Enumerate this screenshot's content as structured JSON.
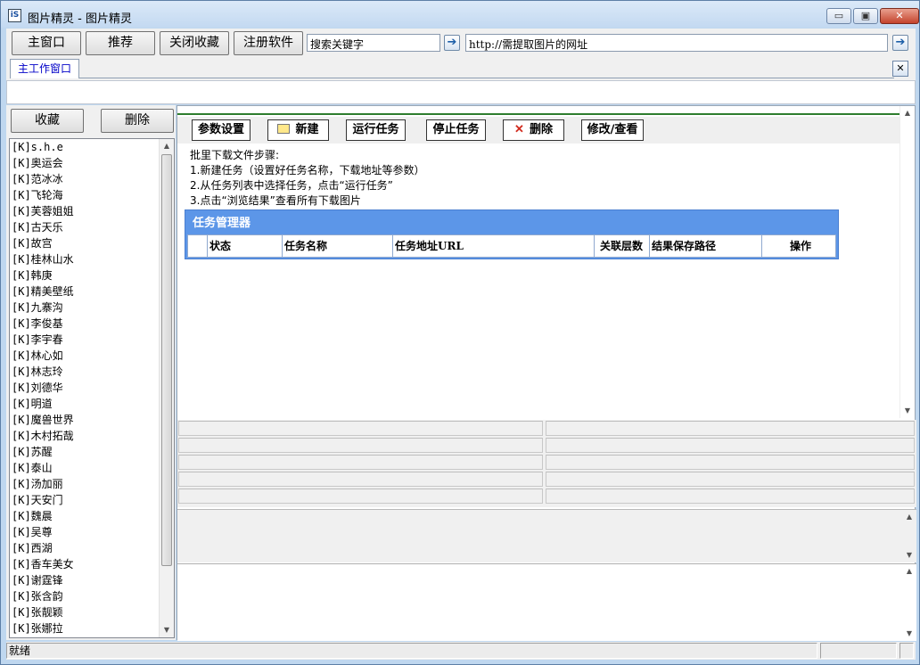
{
  "window": {
    "title": "图片精灵 - 图片精灵",
    "icon_text": "iS",
    "minimize": "▭",
    "maximize": "▣",
    "close": "✕"
  },
  "toolbar": {
    "main_window": "主窗口",
    "recommend": "推荐",
    "close_favorites": "关闭收藏",
    "register": "注册软件",
    "search_value": "搜索关键字",
    "url_value": "http://需提取图片的网址"
  },
  "tabs": {
    "main_work": "主工作窗口"
  },
  "sidebar": {
    "favorites_button": "收藏",
    "delete_button": "删除",
    "items": [
      "[K]s.h.e",
      "[K]奥运会",
      "[K]范冰冰",
      "[K]飞轮海",
      "[K]芙蓉姐姐",
      "[K]古天乐",
      "[K]故宫",
      "[K]桂林山水",
      "[K]韩庚",
      "[K]精美壁纸",
      "[K]九寨沟",
      "[K]李俊基",
      "[K]李宇春",
      "[K]林心如",
      "[K]林志玲",
      "[K]刘德华",
      "[K]明道",
      "[K]魔兽世界",
      "[K]木村拓哉",
      "[K]苏醒",
      "[K]泰山",
      "[K]汤加丽",
      "[K]天安门",
      "[K]魏晨",
      "[K]吴尊",
      "[K]西湖",
      "[K]香车美女",
      "[K]谢霆锋",
      "[K]张含韵",
      "[K]张靓颖",
      "[K]张娜拉"
    ]
  },
  "actions": {
    "params": "参数设置",
    "new": "新建",
    "run": "运行任务",
    "stop": "停止任务",
    "delete": "删除",
    "edit": "修改/查看"
  },
  "instructions": {
    "heading": "批里下载文件步骤:",
    "step1": "1.新建任务（设置好任务名称，下载地址等参数）",
    "step2": "2.从任务列表中选择任务，点击“运行任务”",
    "step3": "3.点击“浏览结果”查看所有下载图片"
  },
  "task_manager": {
    "title": "任务管理器",
    "columns": [
      "状态",
      "任务名称",
      "任务地址URL",
      "关联层数",
      "结果保存路径",
      "操作"
    ]
  },
  "status": {
    "text": "就绪"
  }
}
